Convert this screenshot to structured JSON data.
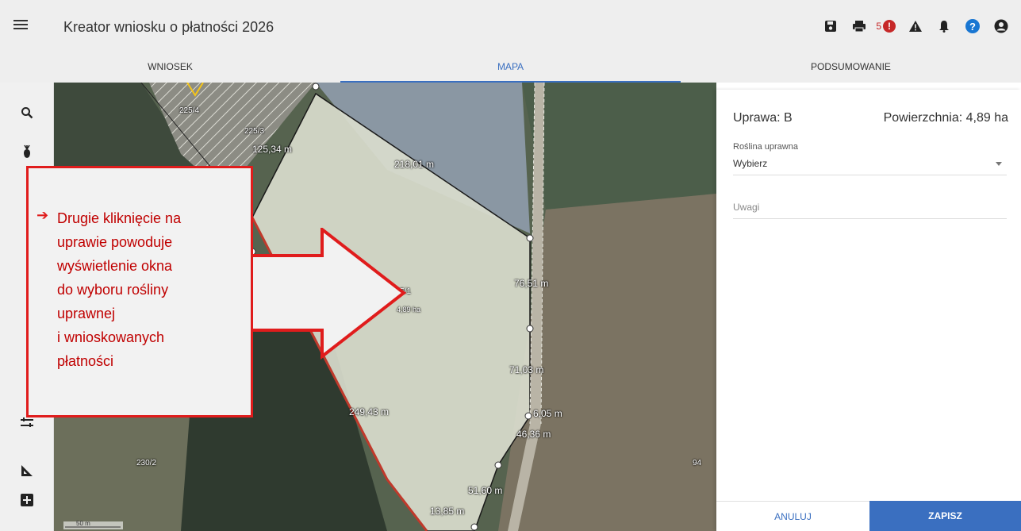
{
  "app": {
    "title": "Kreator wniosku o płatności 2026"
  },
  "toolbar": {
    "icons": [
      "save-icon",
      "print-icon",
      "error-icon",
      "warning-icon",
      "bell-icon",
      "help-icon",
      "user-icon"
    ],
    "error_count": "5",
    "error_mark": "!",
    "help_mark": "?"
  },
  "tabs": [
    {
      "label": "WNIOSEK"
    },
    {
      "label": "MAPA",
      "active": true
    },
    {
      "label": "PODSUMOWANIE"
    }
  ],
  "sidebar": {
    "icons": [
      "search-icon",
      "crop-icon",
      "layers-icon",
      "measure-icon",
      "add-icon"
    ]
  },
  "map": {
    "parcel_labels": [
      "225/4",
      "225/3",
      "225/1",
      "230/2",
      "94"
    ],
    "parcel_area": "4,89 ha",
    "segment_lengths": [
      "125,34 m",
      "218,01 m",
      "76,51 m",
      "71,03 m",
      "249,43 m",
      "6,05 m",
      "46,36 m",
      "51,60 m",
      "13,85 m"
    ],
    "scale_label": "50 m",
    "colors": {
      "selected_fill": "#d9dccd",
      "boundary": "#1a1a1a",
      "highlight_edge": "#c0392b"
    }
  },
  "panel": {
    "crop_label": "Uprawa: B",
    "area_label": "Powierzchnia: 4,89 ha",
    "plant_caption": "Roślina uprawna",
    "plant_value": "Wybierz",
    "notes_placeholder": "Uwagi",
    "cancel_label": "ANULUJ",
    "save_label": "ZAPISZ",
    "accent": "#3a6fc0"
  },
  "callout": {
    "arrow": "➔",
    "lines": [
      "Drugie kliknięcie na",
      "uprawie powoduje",
      "wyświetlenie okna",
      "do wyboru rośliny",
      "uprawnej",
      "i wnioskowanych",
      "płatności"
    ],
    "border_color": "#e01c1c",
    "text_color": "#c00000"
  }
}
